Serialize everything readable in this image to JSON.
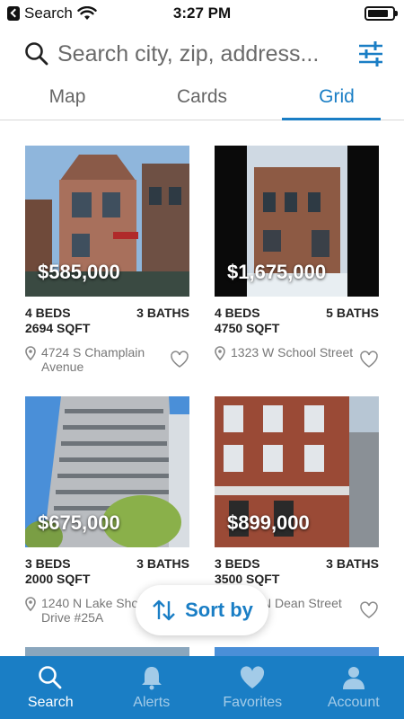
{
  "status": {
    "back_label": "Search",
    "time": "3:27 PM"
  },
  "search": {
    "placeholder": "Search city, zip, address..."
  },
  "tabs": [
    {
      "label": "Map",
      "active": false
    },
    {
      "label": "Cards",
      "active": false
    },
    {
      "label": "Grid",
      "active": true
    }
  ],
  "listings": [
    {
      "price": "$585,000",
      "beds": "4 BEDS",
      "baths": "3 BATHS",
      "sqft": "2694 SQFT",
      "address": "4724 S Champlain Avenue"
    },
    {
      "price": "$1,675,000",
      "beds": "4 BEDS",
      "baths": "5 BATHS",
      "sqft": "4750 SQFT",
      "address": "1323 W School Street"
    },
    {
      "price": "$675,000",
      "beds": "3 BEDS",
      "baths": "3 BATHS",
      "sqft": "2000 SQFT",
      "address": "1240 N Lake Shore Drive #25A"
    },
    {
      "price": "$899,000",
      "beds": "3 BEDS",
      "baths": "3 BATHS",
      "sqft": "3500 SQFT",
      "address": "1720 N Dean Street"
    }
  ],
  "sort": {
    "label": "Sort by"
  },
  "nav": [
    {
      "label": "Search",
      "icon": "search-icon",
      "active": true
    },
    {
      "label": "Alerts",
      "icon": "bell-icon",
      "active": false
    },
    {
      "label": "Favorites",
      "icon": "heart-icon",
      "active": false
    },
    {
      "label": "Account",
      "icon": "person-icon",
      "active": false
    }
  ],
  "colors": {
    "accent": "#1a7ec5",
    "nav_bg": "#1a7ec5"
  }
}
